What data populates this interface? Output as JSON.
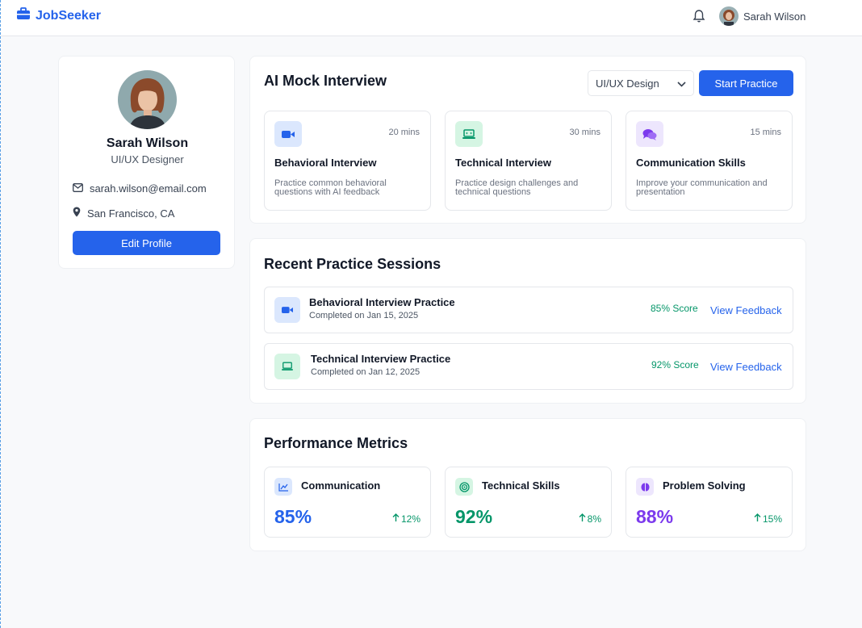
{
  "app": {
    "name": "JobSeeker"
  },
  "header": {
    "user_name": "Sarah Wilson"
  },
  "profile": {
    "name": "Sarah Wilson",
    "role": "UI/UX Designer",
    "email": "sarah.wilson@email.com",
    "location": "San Francisco, CA",
    "edit_label": "Edit Profile"
  },
  "mock_interview": {
    "title": "AI Mock Interview",
    "select_value": "UI/UX Design",
    "start_label": "Start Practice",
    "cards": [
      {
        "title": "Behavioral Interview",
        "duration": "20 mins",
        "description": "Practice common behavioral questions with AI feedback",
        "icon": "video-icon"
      },
      {
        "title": "Technical Interview",
        "duration": "30 mins",
        "description": "Practice design challenges and technical questions",
        "icon": "laptop-code-icon"
      },
      {
        "title": "Communication Skills",
        "duration": "15 mins",
        "description": "Improve your communication and presentation",
        "icon": "chat-bubbles-icon"
      }
    ]
  },
  "sessions": {
    "title": "Recent Practice Sessions",
    "items": [
      {
        "title": "Behavioral Interview Practice",
        "date": "Completed on Jan 15, 2025",
        "score": "85% Score",
        "action": "View Feedback",
        "icon": "video-icon"
      },
      {
        "title": "Technical Interview Practice",
        "date": "Completed on Jan 12, 2025",
        "score": "92% Score",
        "action": "View Feedback",
        "icon": "laptop-code-icon"
      }
    ]
  },
  "metrics": {
    "title": "Performance Metrics",
    "items": [
      {
        "label": "Communication",
        "value": "85%",
        "change": "12%",
        "color": "#2563eb",
        "icon": "line-chart-icon"
      },
      {
        "label": "Technical Skills",
        "value": "92%",
        "change": "8%",
        "color": "#059669",
        "icon": "target-icon"
      },
      {
        "label": "Problem Solving",
        "value": "88%",
        "change": "15%",
        "color": "#7c3aed",
        "icon": "brain-icon"
      }
    ]
  },
  "colors": {
    "primary": "#2563eb",
    "success": "#059669",
    "purple": "#7c3aed"
  }
}
